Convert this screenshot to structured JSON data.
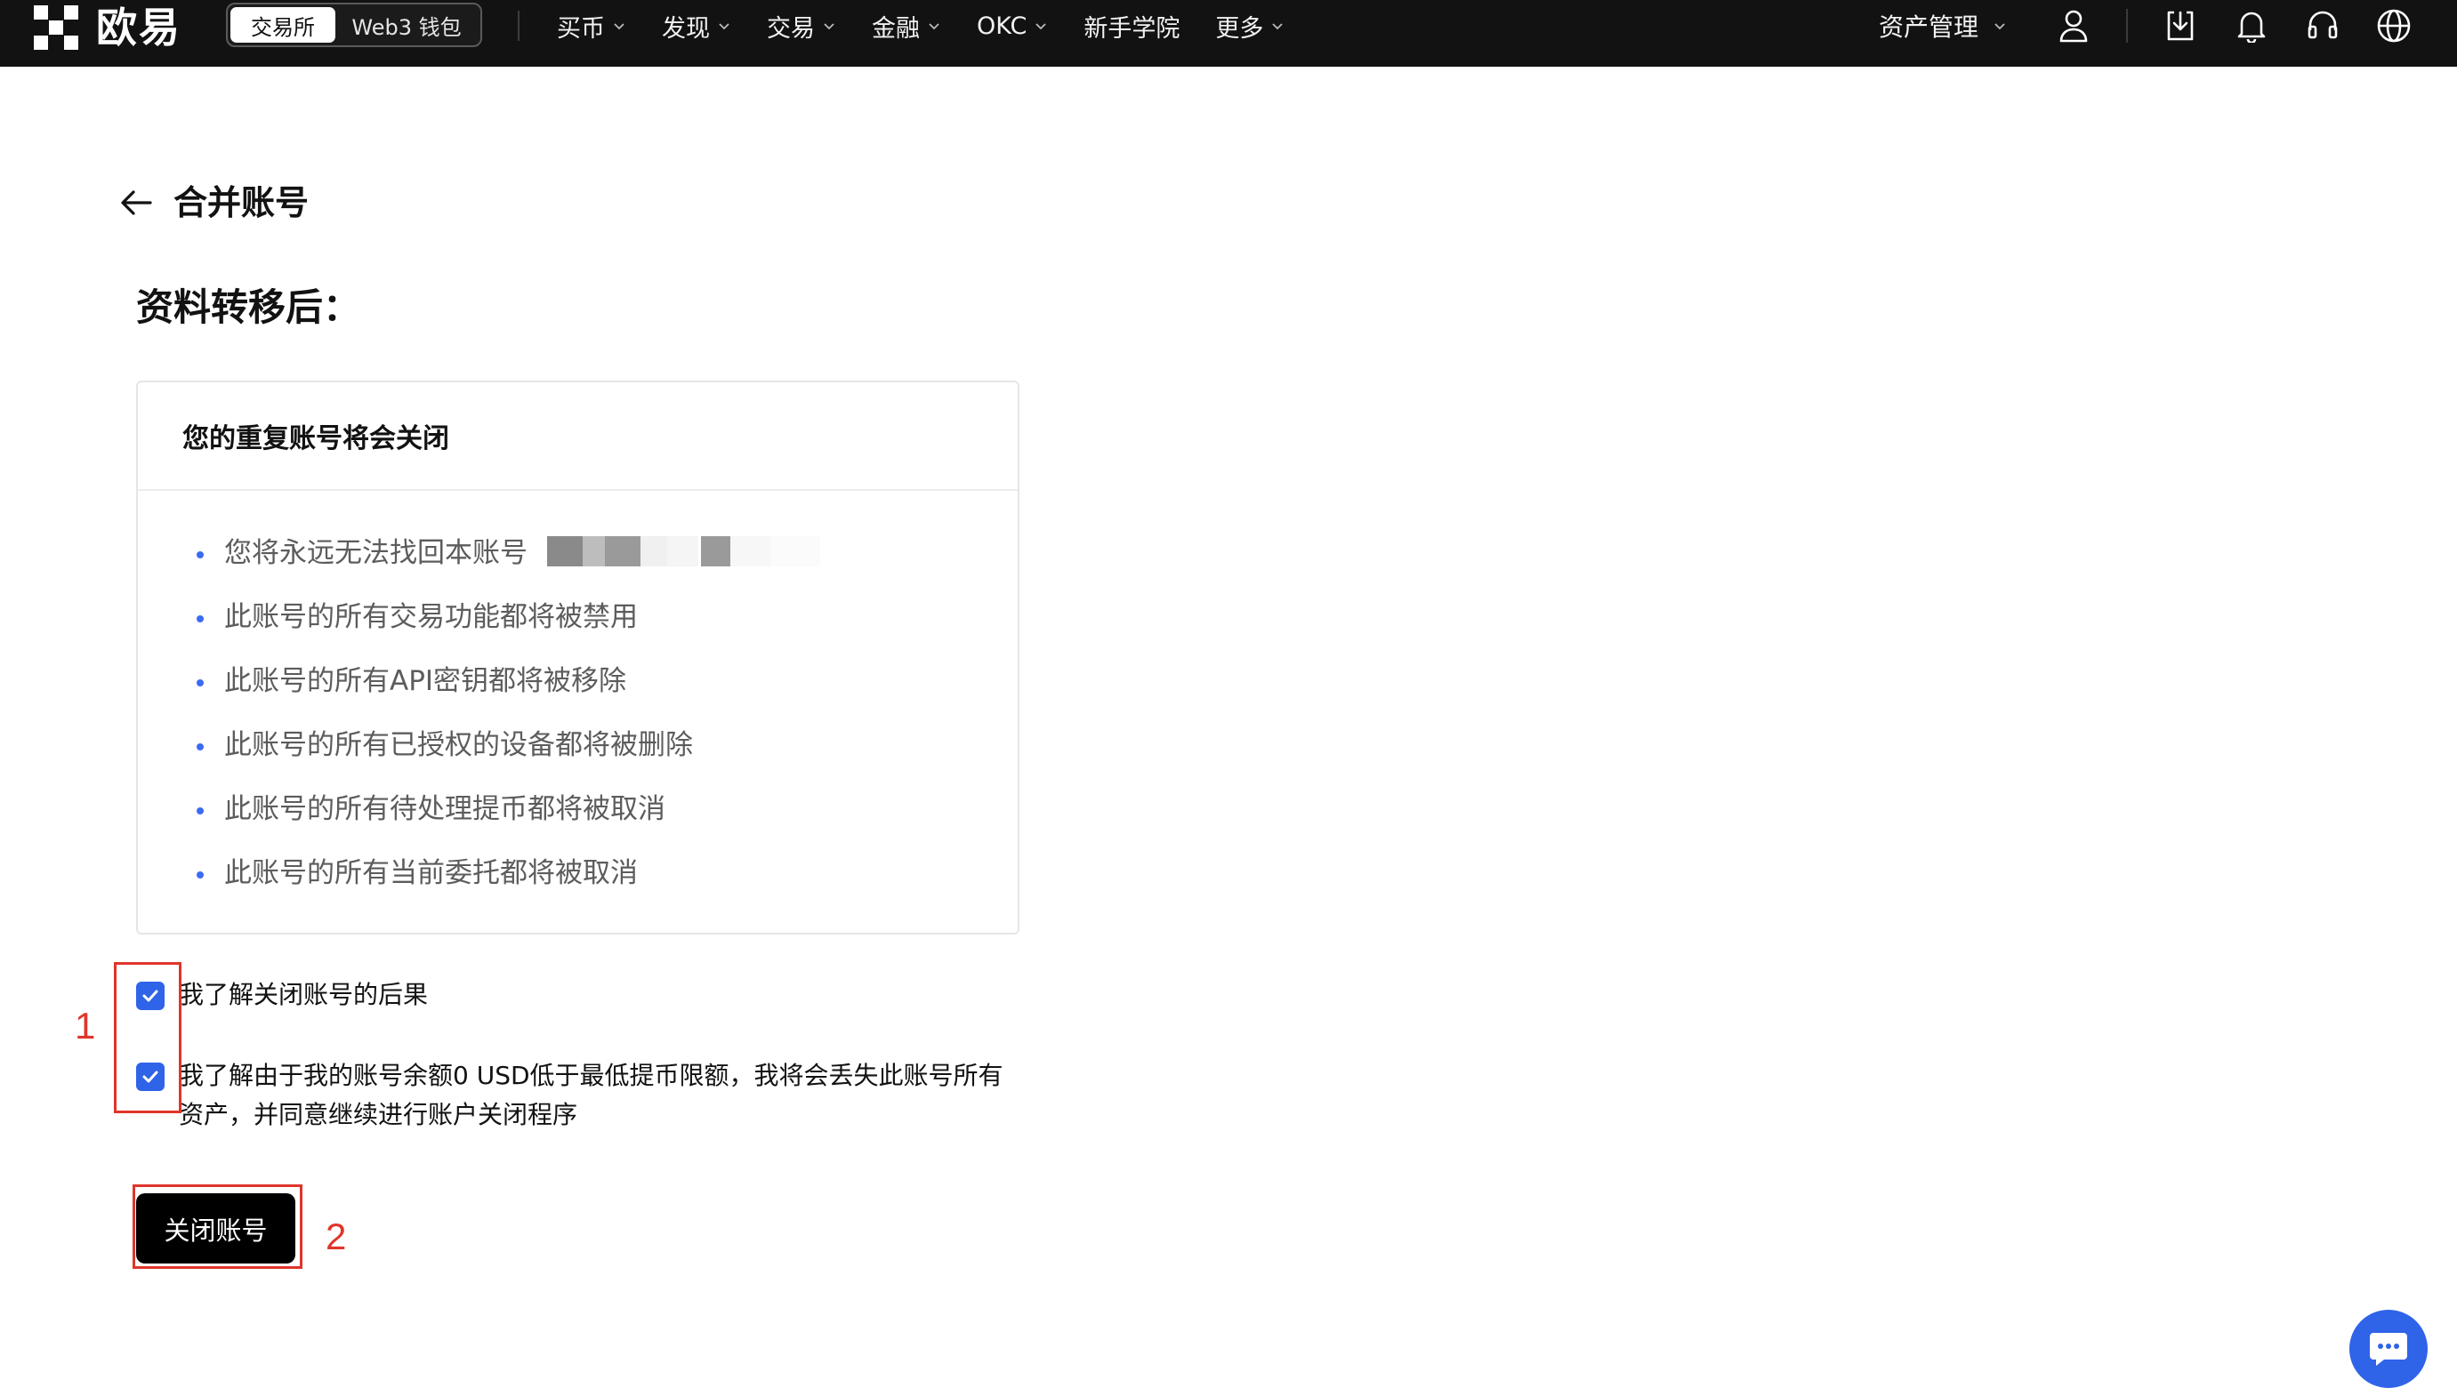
{
  "nav": {
    "logo_text": "欧易",
    "mode_tabs": [
      "交易所",
      "Web3 钱包"
    ],
    "menu": [
      "买币",
      "发现",
      "交易",
      "金融",
      "OKC",
      "新手学院",
      "更多"
    ],
    "asset_label": "资产管理",
    "icons": [
      "user-icon",
      "download-icon",
      "bell-icon",
      "headset-icon",
      "globe-icon"
    ]
  },
  "page": {
    "title": "合并账号",
    "section_title": "资料转移后："
  },
  "card": {
    "header": "您的重复账号将会关闭",
    "items": [
      "您将永远无法找回本账号",
      "此账号的所有交易功能都将被禁用",
      "此账号的所有API密钥都将被移除",
      "此账号的所有已授权的设备都将被删除",
      "此账号的所有待处理提币都将被取消",
      "此账号的所有当前委托都将被取消"
    ]
  },
  "checks": [
    {
      "label": "我了解关闭账号的后果",
      "checked": true
    },
    {
      "label": "我了解由于我的账号余额0 USD低于最低提币限额，我将会丢失此账号所有资产，并同意继续进行账户关闭程序",
      "checked": true
    }
  ],
  "close_button": "关闭账号",
  "annotations": [
    "1",
    "2"
  ],
  "colors": {
    "accent": "#2f63e8",
    "annotation": "#e0352b",
    "nav_bg": "#121212"
  }
}
